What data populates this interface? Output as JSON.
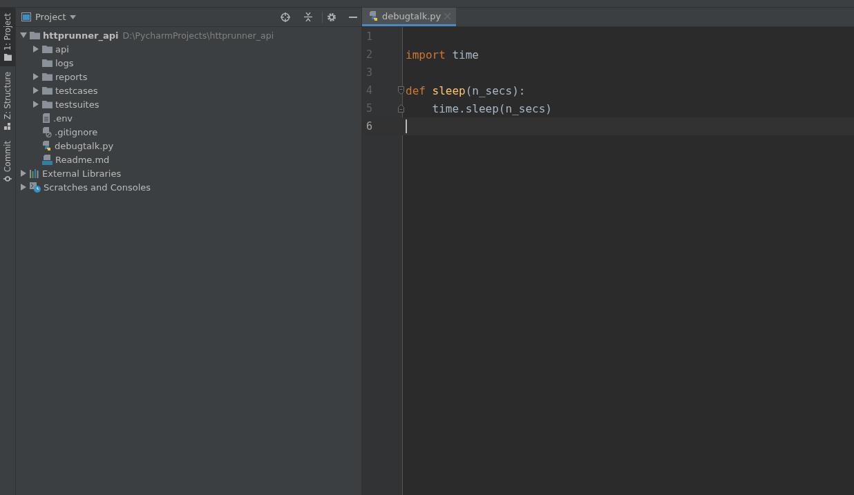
{
  "tool_tabs": [
    {
      "label": "1: Project",
      "selected": true,
      "kind": "project"
    },
    {
      "label": "Z: Structure",
      "selected": false,
      "kind": "structure"
    },
    {
      "label": "Commit",
      "selected": false,
      "kind": "commit"
    }
  ],
  "project_panel": {
    "title": "Project",
    "tree": [
      {
        "label": "httprunner_api",
        "path": "D:\\PycharmProjects\\httprunner_api",
        "kind": "folder",
        "expanded": true,
        "children": [
          {
            "label": "api",
            "kind": "folder",
            "expanded": false
          },
          {
            "label": "logs",
            "kind": "folder"
          },
          {
            "label": "reports",
            "kind": "folder",
            "expanded": false
          },
          {
            "label": "testcases",
            "kind": "folder",
            "expanded": false
          },
          {
            "label": "testsuites",
            "kind": "folder",
            "expanded": false
          },
          {
            "label": ".env",
            "kind": "text_file"
          },
          {
            "label": ".gitignore",
            "kind": "ignore_file"
          },
          {
            "label": "debugtalk.py",
            "kind": "python_file"
          },
          {
            "label": "Readme.md",
            "kind": "markdown_file"
          }
        ]
      },
      {
        "label": "External Libraries",
        "kind": "library",
        "expanded": false
      },
      {
        "label": "Scratches and Consoles",
        "kind": "scratches",
        "expanded": false
      }
    ]
  },
  "editor": {
    "tabs": [
      {
        "label": "debugtalk.py",
        "selected": true
      }
    ],
    "lines": [
      {
        "number": "1",
        "current": false
      },
      {
        "number": "2",
        "current": false,
        "tokens": [
          {
            "kind": "keyword",
            "text": "import"
          },
          {
            "kind": "plain",
            "text": " time"
          }
        ]
      },
      {
        "number": "3",
        "current": false
      },
      {
        "number": "4",
        "current": false,
        "fold_start": true,
        "tokens": [
          {
            "kind": "keyword",
            "text": "def"
          },
          {
            "kind": "function",
            "text": " sleep"
          },
          {
            "kind": "plain",
            "text": "(n_secs):"
          }
        ]
      },
      {
        "number": "5",
        "current": false,
        "fold_end": true,
        "tokens": [
          {
            "kind": "plain",
            "text": "    time.sleep(n_secs)"
          }
        ]
      },
      {
        "number": "6",
        "current": true
      }
    ]
  }
}
